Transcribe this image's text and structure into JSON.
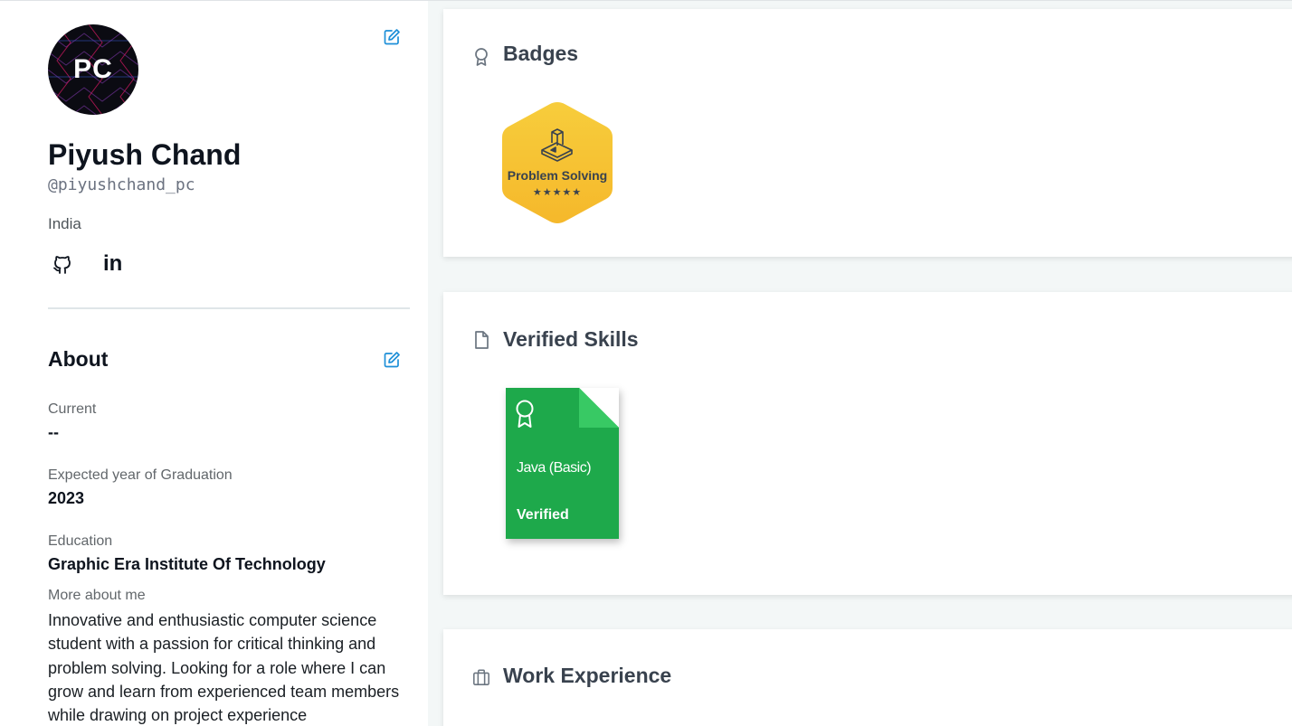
{
  "profile": {
    "initials": "PC",
    "name": "Piyush Chand",
    "handle": "@piyushchand_pc",
    "country": "India",
    "social": [
      {
        "icon": "github-icon"
      },
      {
        "icon": "linkedin-icon",
        "label": "in"
      }
    ]
  },
  "about": {
    "title": "About",
    "current_label": "Current",
    "current_value": "--",
    "graduation_label": "Expected year of Graduation",
    "graduation_value": "2023",
    "education_label": "Education",
    "education_value": "Graphic Era Institute Of Technology",
    "more_label": "More about me",
    "bio": "Innovative and enthusiastic computer science student with a passion for critical thinking and problem solving. Looking for a role where I can grow and learn from experienced team members while drawing on project experience"
  },
  "badges": {
    "title": "Badges",
    "items": [
      {
        "name": "Problem Solving",
        "stars": "★★★★★",
        "star_count": 5,
        "color": "#f5c333"
      }
    ]
  },
  "verified_skills": {
    "title": "Verified Skills",
    "items": [
      {
        "name": "Java (Basic)",
        "status": "Verified",
        "color": "#1ea94b"
      }
    ]
  },
  "work_experience": {
    "title": "Work Experience"
  },
  "colors": {
    "accent_link": "#1d8fd8",
    "skill_green": "#1ea94b",
    "badge_gold": "#f5c333",
    "page_bg": "#f3f7f7"
  }
}
